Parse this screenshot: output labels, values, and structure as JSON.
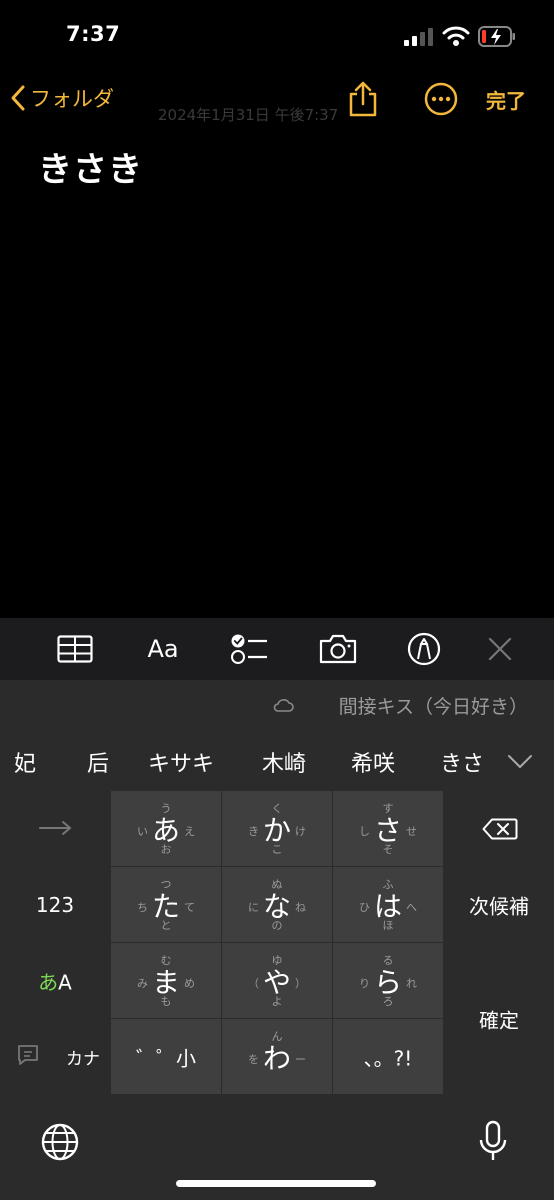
{
  "status_bar": {
    "time": "7:37"
  },
  "nav": {
    "back_label": "フォルダ",
    "date_ghost": "2024年1月31日 午後7:37",
    "done_label": "完了"
  },
  "note": {
    "title": "きさき"
  },
  "toolbar": {
    "format_label": "Aa"
  },
  "keyboard": {
    "suggestion": "間接キス（今日好き）",
    "candidates": [
      "妃",
      "后",
      "キサキ",
      "木崎",
      "希咲",
      "きさ"
    ],
    "kana_keys": [
      {
        "main": "あ",
        "top": "う",
        "left": "い",
        "right": "え",
        "bottom": "お"
      },
      {
        "main": "か",
        "top": "く",
        "left": "き",
        "right": "け",
        "bottom": "こ"
      },
      {
        "main": "さ",
        "top": "す",
        "left": "し",
        "right": "せ",
        "bottom": "そ"
      },
      {
        "main": "た",
        "top": "つ",
        "left": "ち",
        "right": "て",
        "bottom": "と"
      },
      {
        "main": "な",
        "top": "ぬ",
        "left": "に",
        "right": "ね",
        "bottom": "の"
      },
      {
        "main": "は",
        "top": "ふ",
        "left": "ひ",
        "right": "へ",
        "bottom": "ほ"
      },
      {
        "main": "ま",
        "top": "む",
        "left": "み",
        "right": "め",
        "bottom": "も"
      },
      {
        "main": "や",
        "top": "ゆ",
        "left": "（",
        "right": "）",
        "bottom": "よ"
      },
      {
        "main": "ら",
        "top": "る",
        "left": "り",
        "right": "れ",
        "bottom": "ろ"
      },
      {
        "main": "゛゜小",
        "top": "",
        "left": "",
        "right": "",
        "bottom": ""
      },
      {
        "main": "わ",
        "top": "ん",
        "left": "を",
        "right": "ー",
        "bottom": ""
      },
      {
        "main": "、。?!",
        "top": "",
        "left": "",
        "right": "",
        "bottom": ""
      }
    ],
    "num_label": "123",
    "mode_label_a": "あ",
    "mode_label_b": "A",
    "kana_label": "カナ",
    "next_label": "次候補",
    "confirm_label": "確定"
  },
  "colors": {
    "accent": "#f2b73b",
    "mode_green": "#7ed957"
  }
}
